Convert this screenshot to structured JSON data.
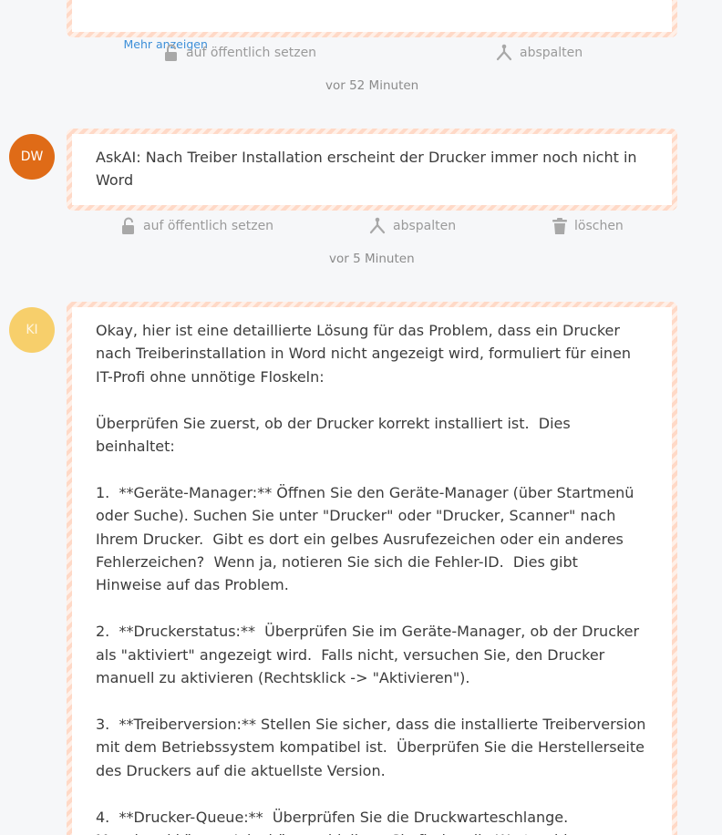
{
  "msg0": {
    "show_more": "Mehr anzeigen",
    "action_public": "auf öffentlich setzen",
    "action_split": "abspalten",
    "time": "vor 52 Minuten"
  },
  "msg1": {
    "avatar": "DW",
    "text": "AskAI: Nach Treiber Installation erscheint der Drucker immer noch nicht in Word",
    "action_public": "auf öffentlich setzen",
    "action_split": "abspalten",
    "action_delete": "löschen",
    "time": "vor 5 Minuten"
  },
  "msg2": {
    "avatar": "KI",
    "text": "Okay, hier ist eine detaillierte Lösung für das Problem, dass ein Drucker nach Treiberinstallation in Word nicht angezeigt wird, formuliert für einen IT-Profi ohne unnötige Floskeln:\n\nÜberprüfen Sie zuerst, ob der Drucker korrekt installiert ist.  Dies beinhaltet:\n\n1.  **Geräte-Manager:** Öffnen Sie den Geräte-Manager (über Startmenü oder Suche). Suchen Sie unter \"Drucker\" oder \"Drucker, Scanner\" nach Ihrem Drucker.  Gibt es dort ein gelbes Ausrufezeichen oder ein anderes Fehlerzeichen?  Wenn ja, notieren Sie sich die Fehler-ID.  Dies gibt Hinweise auf das Problem.\n\n2.  **Druckerstatus:**  Überprüfen Sie im Geräte-Manager, ob der Drucker als \"aktiviert\" angezeigt wird.  Falls nicht, versuchen Sie, den Drucker manuell zu aktivieren (Rechtsklick -> \"Aktivieren\").\n\n3.  **Treiberversion:** Stellen Sie sicher, dass die installierte Treiberversion mit dem Betriebssystem kompatibel ist.  Überprüfen Sie die Herstellerseite des Druckers auf die aktuellste Version.\n\n4.  **Drucker-Queue:**  Überprüfen Sie die Druckwarteschlange.  Manchmal können Jobs hängen bleiben. Sie finden die Warteschlange, indem Sie auf den Drucker klicken."
  },
  "colors": {
    "avatar_dw": "#df6b17",
    "avatar_ki": "#f7cf6b",
    "link": "#3d8fd8",
    "stripe": "#ffd9c7"
  }
}
